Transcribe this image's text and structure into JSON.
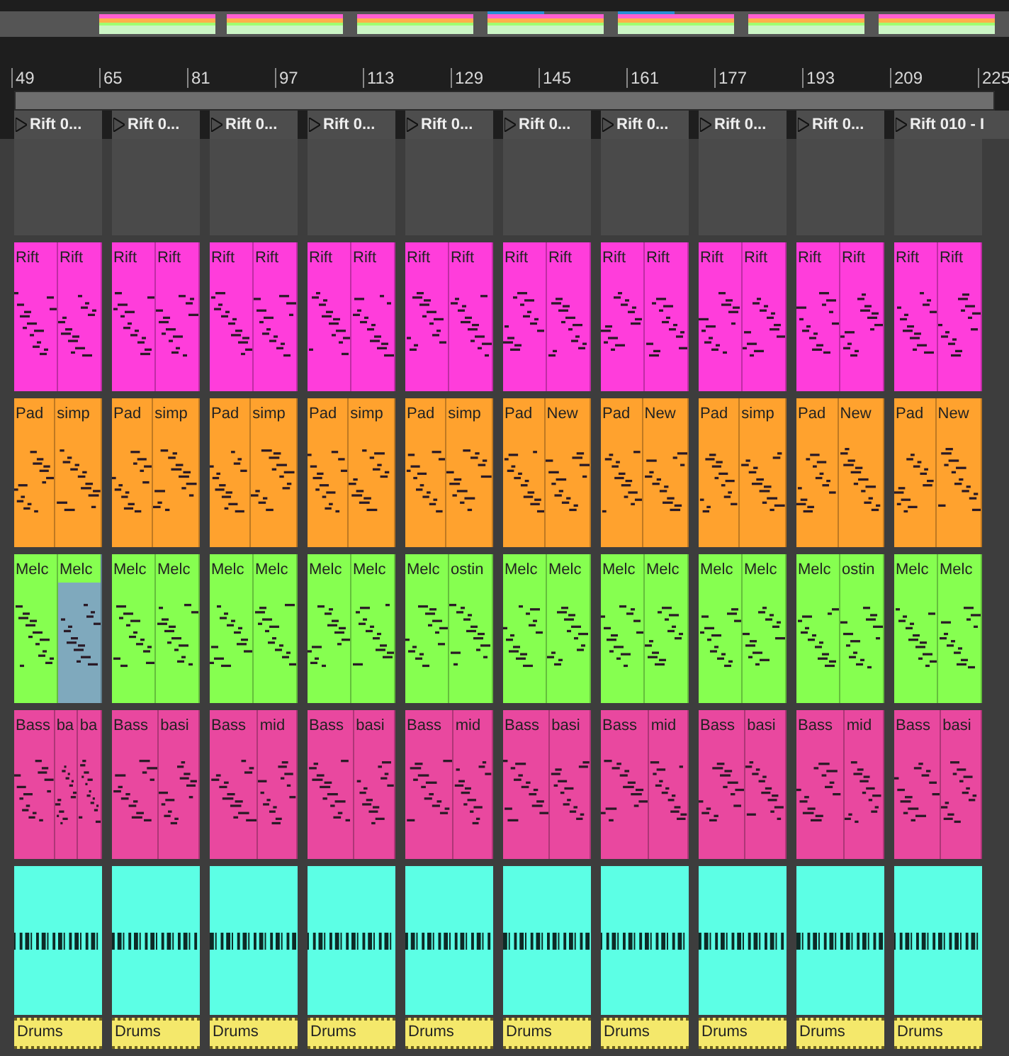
{
  "ruler": {
    "marks": [
      "49",
      "65",
      "81",
      "97",
      "113",
      "129",
      "145",
      "161",
      "177",
      "193",
      "209",
      "225"
    ]
  },
  "scenes": [
    "Rift 0...",
    "Rift 0...",
    "Rift 0...",
    "Rift 0...",
    "Rift 0...",
    "Rift 0...",
    "Rift 0...",
    "Rift 0...",
    "Rift 0...",
    "Rift 010 - I"
  ],
  "tracks": [
    {
      "color": "#ff3ddb",
      "columns": [
        [
          {
            "label": "Rift",
            "selected": false
          },
          {
            "label": "Rift",
            "selected": false
          }
        ],
        [
          {
            "label": "Rift",
            "selected": false
          },
          {
            "label": "Rift",
            "selected": false
          }
        ],
        [
          {
            "label": "Rift",
            "selected": false
          },
          {
            "label": "Rift",
            "selected": false
          }
        ],
        [
          {
            "label": "Rift",
            "selected": false
          },
          {
            "label": "Rift",
            "selected": false
          }
        ],
        [
          {
            "label": "Rift",
            "selected": false
          },
          {
            "label": "Rift",
            "selected": false
          }
        ],
        [
          {
            "label": "Rift",
            "selected": false
          },
          {
            "label": "Rift",
            "selected": false
          }
        ],
        [
          {
            "label": "Rift",
            "selected": false
          },
          {
            "label": "Rift",
            "selected": false
          }
        ],
        [
          {
            "label": "Rift",
            "selected": false
          },
          {
            "label": "Rift",
            "selected": false
          }
        ],
        [
          {
            "label": "Rift",
            "selected": false
          },
          {
            "label": "Rift",
            "selected": false
          }
        ],
        [
          {
            "label": "Rift",
            "selected": false
          },
          {
            "label": "Rift",
            "selected": false
          }
        ]
      ]
    },
    {
      "color": "#ffa22e",
      "columns": [
        [
          {
            "label": "Pad",
            "selected": false
          },
          {
            "label": "simp",
            "selected": false
          }
        ],
        [
          {
            "label": "Pad",
            "selected": false
          },
          {
            "label": "simp",
            "selected": false
          }
        ],
        [
          {
            "label": "Pad",
            "selected": false
          },
          {
            "label": "simp",
            "selected": false
          }
        ],
        [
          {
            "label": "Pad",
            "selected": false
          },
          {
            "label": "simp",
            "selected": false
          }
        ],
        [
          {
            "label": "Pad",
            "selected": false
          },
          {
            "label": "simp",
            "selected": false
          }
        ],
        [
          {
            "label": "Pad",
            "selected": false
          },
          {
            "label": "New",
            "selected": false
          }
        ],
        [
          {
            "label": "Pad",
            "selected": false
          },
          {
            "label": "New",
            "selected": false
          }
        ],
        [
          {
            "label": "Pad",
            "selected": false
          },
          {
            "label": "simp",
            "selected": false
          }
        ],
        [
          {
            "label": "Pad",
            "selected": false
          },
          {
            "label": "New",
            "selected": false
          }
        ],
        [
          {
            "label": "Pad",
            "selected": false
          },
          {
            "label": "New",
            "selected": false
          }
        ]
      ]
    },
    {
      "color": "#86ff50",
      "columns": [
        [
          {
            "label": "Melc",
            "selected": false
          },
          {
            "label": "Melc",
            "selected": true
          }
        ],
        [
          {
            "label": "Melc",
            "selected": false
          },
          {
            "label": "Melc",
            "selected": false
          }
        ],
        [
          {
            "label": "Melc",
            "selected": false
          },
          {
            "label": "Melc",
            "selected": false
          }
        ],
        [
          {
            "label": "Melc",
            "selected": false
          },
          {
            "label": "Melc",
            "selected": false
          }
        ],
        [
          {
            "label": "Melc",
            "selected": false
          },
          {
            "label": "ostin",
            "selected": false
          }
        ],
        [
          {
            "label": "Melc",
            "selected": false
          },
          {
            "label": "Melc",
            "selected": false
          }
        ],
        [
          {
            "label": "Melc",
            "selected": false
          },
          {
            "label": "Melc",
            "selected": false
          }
        ],
        [
          {
            "label": "Melc",
            "selected": false
          },
          {
            "label": "Melc",
            "selected": false
          }
        ],
        [
          {
            "label": "Melc",
            "selected": false
          },
          {
            "label": "ostin",
            "selected": false
          }
        ],
        [
          {
            "label": "Melc",
            "selected": false
          },
          {
            "label": "Melc",
            "selected": false
          }
        ]
      ]
    },
    {
      "color": "#e9489f",
      "columns": [
        [
          {
            "label": "Bass",
            "selected": false
          },
          {
            "label": "ba",
            "selected": false
          },
          {
            "label": "ba",
            "selected": false
          }
        ],
        [
          {
            "label": "Bass",
            "selected": false
          },
          {
            "label": "basi",
            "selected": false
          }
        ],
        [
          {
            "label": "Bass",
            "selected": false
          },
          {
            "label": "mid",
            "selected": false
          }
        ],
        [
          {
            "label": "Bass",
            "selected": false
          },
          {
            "label": "basi",
            "selected": false
          }
        ],
        [
          {
            "label": "Bass",
            "selected": false
          },
          {
            "label": "mid",
            "selected": false
          }
        ],
        [
          {
            "label": "Bass",
            "selected": false
          },
          {
            "label": "basi",
            "selected": false
          }
        ],
        [
          {
            "label": "Bass",
            "selected": false
          },
          {
            "label": "mid",
            "selected": false
          }
        ],
        [
          {
            "label": "Bass",
            "selected": false
          },
          {
            "label": "basi",
            "selected": false
          }
        ],
        [
          {
            "label": "Bass",
            "selected": false
          },
          {
            "label": "mid",
            "selected": false
          }
        ],
        [
          {
            "label": "Bass",
            "selected": false
          },
          {
            "label": "basi",
            "selected": false
          }
        ]
      ]
    }
  ],
  "drums": {
    "color": "#5cffe5",
    "labels": [
      "Drums",
      "Drums",
      "Drums",
      "Drums",
      "Drums",
      "Drums",
      "Drums",
      "Drums",
      "Drums",
      "Drums"
    ]
  }
}
